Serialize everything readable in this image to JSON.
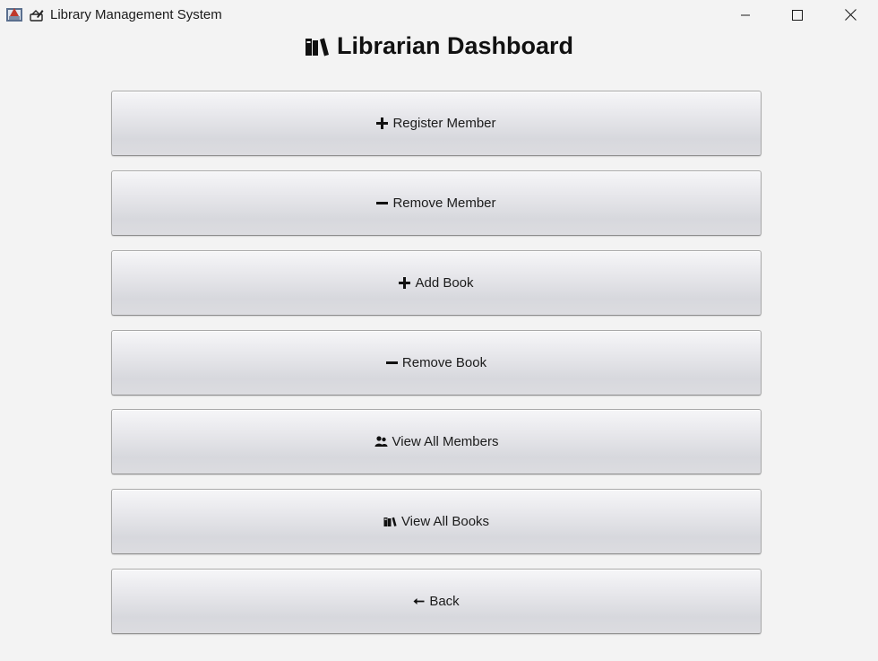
{
  "window": {
    "title": "Library Management System",
    "title_icon": "books-write-icon",
    "controls": [
      "minimize",
      "maximize",
      "close"
    ]
  },
  "dashboard": {
    "title": "Librarian Dashboard",
    "title_icon": "books-icon",
    "buttons": [
      {
        "icon": "plus-icon",
        "label": "Register Member"
      },
      {
        "icon": "minus-icon",
        "label": "Remove Member"
      },
      {
        "icon": "plus-icon",
        "label": "Add Book"
      },
      {
        "icon": "minus-icon",
        "label": "Remove Book"
      },
      {
        "icon": "users-icon",
        "label": "View All Members"
      },
      {
        "icon": "books-icon",
        "label": "View All Books"
      },
      {
        "icon": "left-arrow-icon",
        "label": "Back"
      }
    ]
  },
  "colors": {
    "background": "#f3f3f3",
    "button_top": "#f6f6f8",
    "button_bottom": "#d7d8dd",
    "button_border": "#a9a9a9",
    "text": "#1b1b1b"
  }
}
